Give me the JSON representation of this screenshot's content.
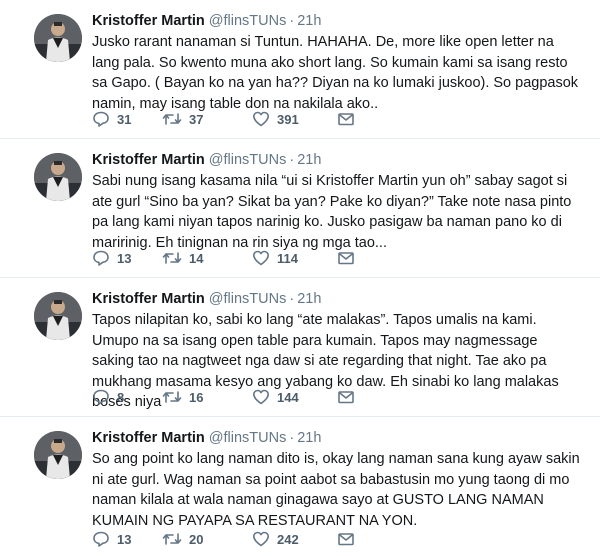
{
  "user": {
    "name": "Kristoffer Martin",
    "handle": "@flinsTUNs",
    "separator": "·"
  },
  "tweets": [
    {
      "time": "21h",
      "text": "Jusko rarant nanaman si Tuntun. HAHAHA. De, more like open letter na lang pala. So kwento muna ako short lang. So kumain kami sa isang resto sa Gapo. ( Bayan ko na yan ha?? Diyan na ko lumaki juskoo). So pagpasok namin, may isang table don na nakilala ako..",
      "replies": "31",
      "retweets": "37",
      "likes": "391"
    },
    {
      "time": "21h",
      "text": "Sabi nung isang kasama nila “ui si Kristoffer Martin yun oh” sabay sagot si ate gurl “Sino ba yan? Sikat ba yan? Pake ko diyan?” Take note nasa pinto pa lang kami niyan tapos narinig ko. Jusko pasigaw ba naman pano ko di maririnig. Eh tinignan na rin siya ng mga tao...",
      "replies": "13",
      "retweets": "14",
      "likes": "114"
    },
    {
      "time": "21h",
      "text": "Tapos nilapitan ko, sabi ko lang “ate malakas”. Tapos umalis na kami. Umupo na sa isang open table para kumain. Tapos may nagmessage saking tao na nagtweet nga daw si ate regarding that night. Tae ako pa mukhang masama kesyo ang yabang ko daw. Eh sinabi ko lang malakas boses niya",
      "replies": "8",
      "retweets": "16",
      "likes": "144"
    },
    {
      "time": "21h",
      "text": "So ang point ko lang naman dito is, okay lang naman sana kung ayaw sakin ni ate gurl. Wag naman sa point aabot sa babastusin mo yung taong di mo naman kilala at wala naman ginagawa sayo at GUSTO LANG NAMAN KUMAIN NG PAYAPA SA RESTAURANT NA YON.",
      "replies": "13",
      "retweets": "20",
      "likes": "242"
    }
  ]
}
